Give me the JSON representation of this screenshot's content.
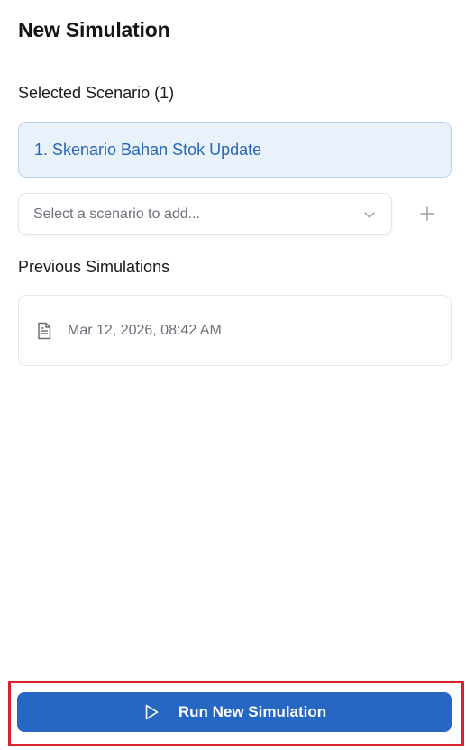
{
  "page": {
    "title": "New Simulation"
  },
  "selected_scenarios": {
    "label": "Selected Scenario (1)",
    "items": [
      {
        "label": "1. Skenario Bahan Stok Update"
      }
    ]
  },
  "scenario_select": {
    "placeholder": "Select a scenario to add...",
    "chevron_icon": "chevron-down-icon",
    "add_icon": "plus-icon"
  },
  "previous_simulations": {
    "label": "Previous Simulations",
    "items": [
      {
        "icon": "document-icon",
        "timestamp": "Mar 12, 2026, 08:42 AM"
      }
    ]
  },
  "footer": {
    "run_button_label": "Run New Simulation",
    "run_button_icon": "play-icon",
    "highlight_color": "#d9232a"
  },
  "colors": {
    "accent": "#2567c2",
    "selected_bg": "#e9f1fa",
    "selected_text": "#2767b5"
  }
}
